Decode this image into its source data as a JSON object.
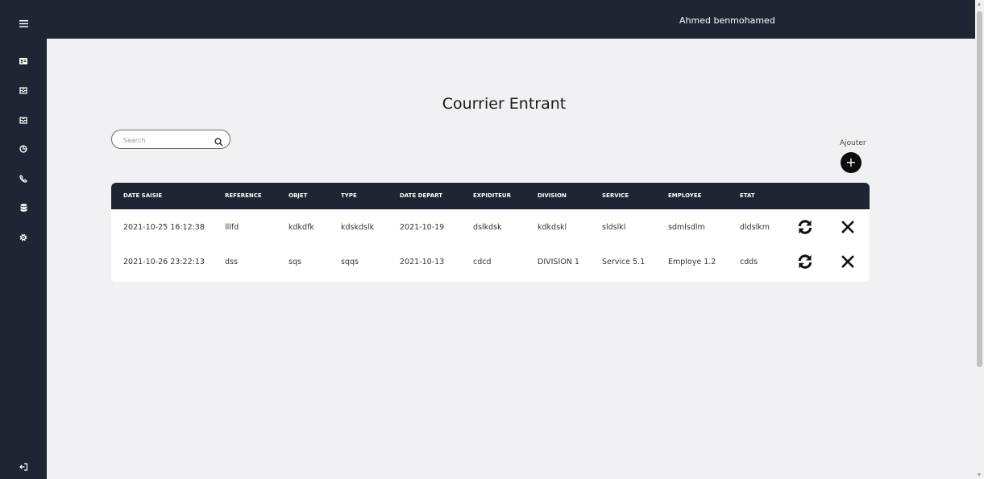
{
  "header": {
    "user_name": "Ahmed benmohamed"
  },
  "sidebar": {
    "icons": [
      "menu-icon",
      "id-card-icon",
      "inbox-icon",
      "outbox-icon",
      "chart-pie-icon",
      "phone-icon",
      "database-icon",
      "settings-icon",
      "logout-icon"
    ]
  },
  "main": {
    "title": "Courrier Entrant",
    "search": {
      "placeholder": "Search",
      "value": ""
    },
    "add_label": "Ajouter",
    "add_symbol": "+"
  },
  "table": {
    "columns": [
      "DATE SAISIE",
      "REFERENCE",
      "OBJET",
      "TYPE",
      "DATE DEPART",
      "EXPIDITEUR",
      "DIVISION",
      "SERVICE",
      "EMPLOYEE",
      "ETAT"
    ],
    "rows": [
      [
        "2021-10-25 16:12:38",
        "lllfd",
        "kdkdfk",
        "kdskdslk",
        "2021-10-19",
        "dslkdsk",
        "kdkdskl",
        "sldslkl",
        "sdmlsdlm",
        "dldslkm"
      ],
      [
        "2021-10-26 23:22:13",
        "dss",
        "sqs",
        "sqqs",
        "2021-10-13",
        "cdcd",
        "DIVISION 1",
        "Service 5.1",
        "Employe 1.2",
        "cdds"
      ]
    ]
  },
  "colors": {
    "dark": "#1f2532",
    "background": "#f1f1f3"
  }
}
